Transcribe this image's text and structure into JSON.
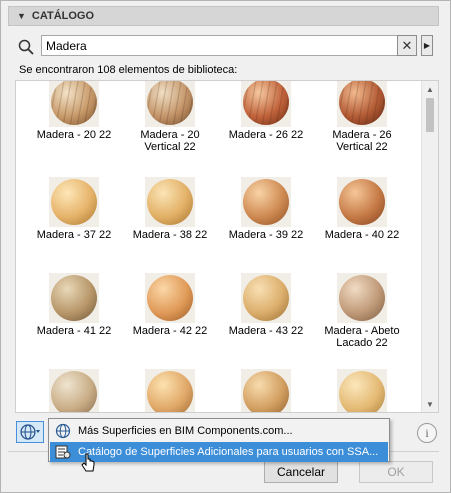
{
  "header": {
    "title": "CATÁLOGO"
  },
  "search": {
    "value": "Madera",
    "clear_symbol": "✕",
    "menu_arrow": "▶"
  },
  "result_count_text": "Se encontraron 108 elementos de biblioteca:",
  "materials": [
    {
      "label": "Madera - 20 22",
      "colors": [
        "#f3e3c8",
        "#c89a6a",
        "#7a4f2c"
      ],
      "stripes": true
    },
    {
      "label": "Madera - 20 Vertical 22",
      "colors": [
        "#f0dfc4",
        "#c49468",
        "#6f4a2c"
      ],
      "stripes": true
    },
    {
      "label": "Madera - 26 22",
      "colors": [
        "#f6c9a0",
        "#c0623a",
        "#6a2a14"
      ],
      "stripes": true
    },
    {
      "label": "Madera - 26 Vertical 22",
      "colors": [
        "#f2b98e",
        "#b25a34",
        "#5e2614"
      ],
      "stripes": true
    },
    {
      "label": "Madera - 37 22",
      "colors": [
        "#fde7b8",
        "#e6b36a",
        "#a8742c"
      ],
      "stripes": false
    },
    {
      "label": "Madera - 38 22",
      "colors": [
        "#fbe5b6",
        "#e2b066",
        "#a5722e"
      ],
      "stripes": false
    },
    {
      "label": "Madera - 39 22",
      "colors": [
        "#f8d3a6",
        "#cf8a52",
        "#8f4e22"
      ],
      "stripes": false
    },
    {
      "label": "Madera - 40 22",
      "colors": [
        "#f6c698",
        "#c57a46",
        "#83411c"
      ],
      "stripes": false
    },
    {
      "label": "Madera - 41 22",
      "colors": [
        "#e8d8b8",
        "#b8976a",
        "#6e5534"
      ],
      "stripes": false
    },
    {
      "label": "Madera - 42 22",
      "colors": [
        "#fbd7a8",
        "#e09a58",
        "#9c5a24"
      ],
      "stripes": false
    },
    {
      "label": "Madera - 43 22",
      "colors": [
        "#f8e0b4",
        "#dcae6c",
        "#9a6c30"
      ],
      "stripes": false
    },
    {
      "label": "Madera - Abeto Lacado 22",
      "colors": [
        "#f1dbc4",
        "#c09a78",
        "#7a5a40"
      ],
      "stripes": false
    },
    {
      "label": "",
      "colors": [
        "#efe4d0",
        "#c9ad86",
        "#86684a"
      ],
      "stripes": false
    },
    {
      "label": "",
      "colors": [
        "#fde2b0",
        "#e0a868",
        "#9c6630"
      ],
      "stripes": false
    },
    {
      "label": "",
      "colors": [
        "#f7dcae",
        "#d29e60",
        "#8e5e2a"
      ],
      "stripes": false
    },
    {
      "label": "",
      "colors": [
        "#fbe7bc",
        "#e4ba74",
        "#a87c38"
      ],
      "stripes": false
    }
  ],
  "popup_menu": {
    "items": [
      {
        "label": "Más Superficies en BIM Components.com...",
        "icon": "globe-icon"
      },
      {
        "label": "Catálogo de Superficies Adicionales para usuarios con SSA...",
        "icon": "catalog-icon"
      }
    ]
  },
  "info_symbol": "i",
  "buttons": {
    "cancel": "Cancelar",
    "ok": "OK"
  }
}
